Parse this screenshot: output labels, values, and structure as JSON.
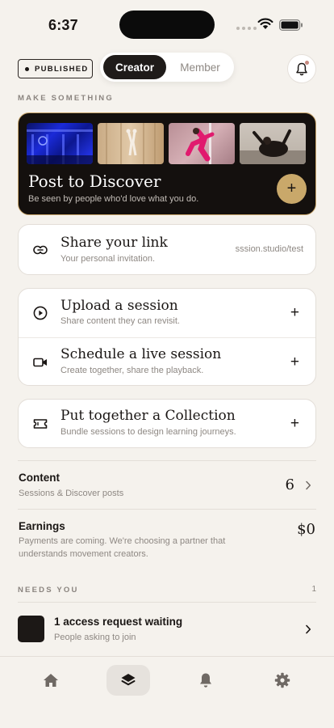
{
  "status": {
    "time": "6:37"
  },
  "header": {
    "badge": "PUBLISHED",
    "segment": {
      "creator": "Creator",
      "member": "Member",
      "selected": "Creator"
    }
  },
  "make": {
    "label": "MAKE SOMETHING",
    "hero": {
      "title": "Post to Discover",
      "subtitle": "Be seen by people who'd love what you do.",
      "add": "+"
    },
    "share": {
      "title": "Share your link",
      "subtitle": "Your personal invitation.",
      "link": "sssion.studio/test"
    },
    "upload": {
      "title": "Upload a session",
      "subtitle": "Share content they can revisit.",
      "add": "+"
    },
    "schedule": {
      "title": "Schedule a live session",
      "subtitle": "Create together, share the playback.",
      "add": "+"
    },
    "collection": {
      "title": "Put together a Collection",
      "subtitle": "Bundle sessions to design learning journeys.",
      "add": "+"
    }
  },
  "stats": {
    "content": {
      "title": "Content",
      "subtitle": "Sessions & Discover posts",
      "value": "6"
    },
    "earnings": {
      "title": "Earnings",
      "subtitle_line1": "Payments are coming. We're choosing a partner that",
      "subtitle_line2": "understands movement creators.",
      "value": "$0"
    }
  },
  "needs": {
    "label": "NEEDS YOU",
    "count": "1",
    "item": {
      "title": "1 access request waiting",
      "subtitle": "People asking to join"
    }
  },
  "tabs": [
    {
      "icon": "home-icon"
    },
    {
      "icon": "layers-icon",
      "active": true
    },
    {
      "icon": "bell-icon"
    },
    {
      "icon": "gear-icon"
    }
  ],
  "colors": {
    "accent": "#c9a86a",
    "dark": "#14100e",
    "background": "#f5f2ed",
    "notification": "#c7897f"
  }
}
